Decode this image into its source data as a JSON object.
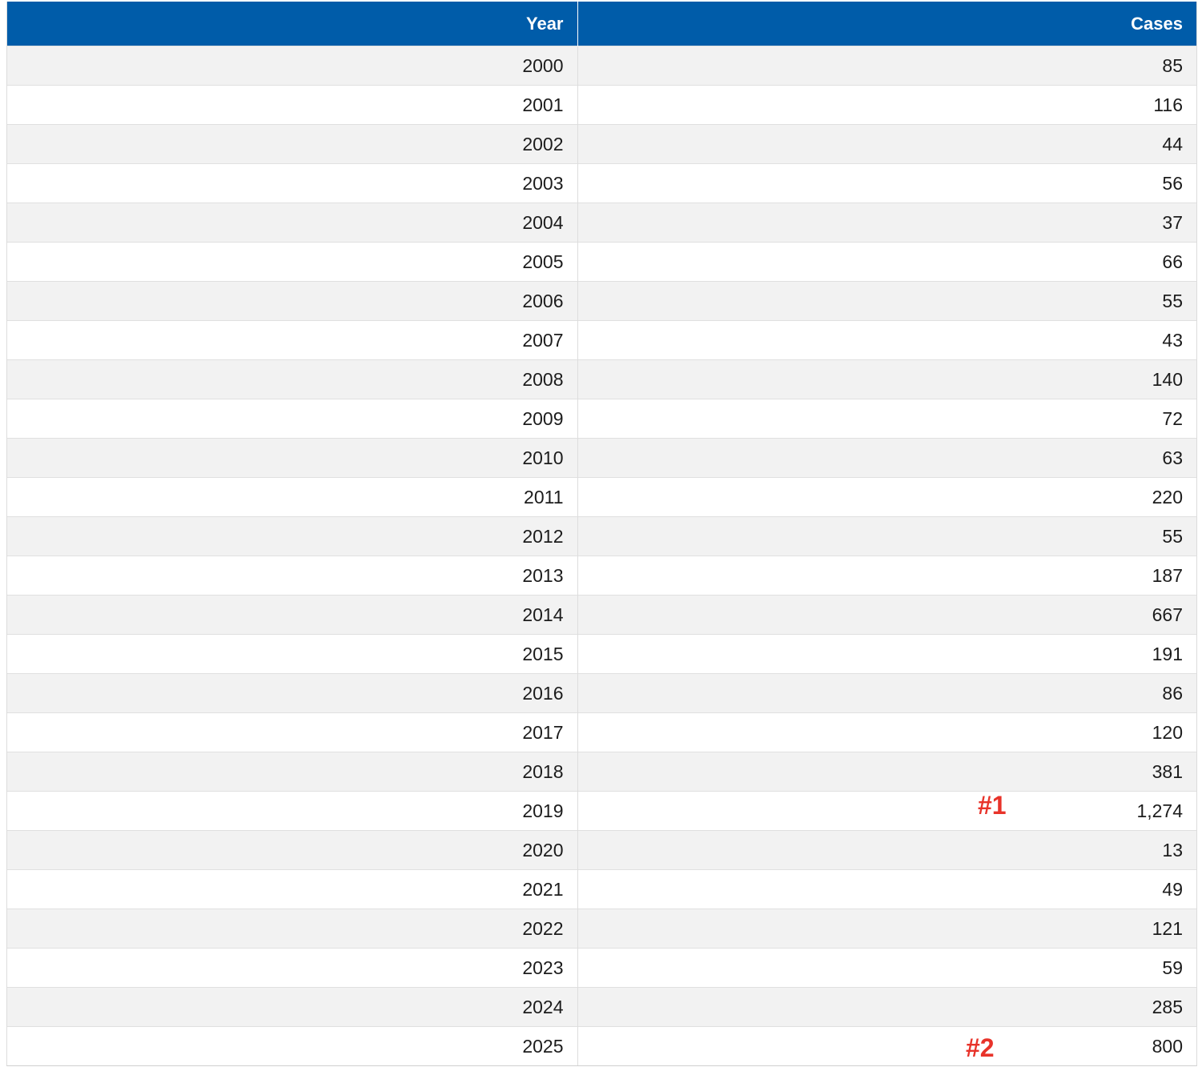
{
  "table": {
    "columns": [
      "Year",
      "Cases"
    ],
    "rows": [
      {
        "year": "2000",
        "cases": "85"
      },
      {
        "year": "2001",
        "cases": "116"
      },
      {
        "year": "2002",
        "cases": "44"
      },
      {
        "year": "2003",
        "cases": "56"
      },
      {
        "year": "2004",
        "cases": "37"
      },
      {
        "year": "2005",
        "cases": "66"
      },
      {
        "year": "2006",
        "cases": "55"
      },
      {
        "year": "2007",
        "cases": "43"
      },
      {
        "year": "2008",
        "cases": "140"
      },
      {
        "year": "2009",
        "cases": "72"
      },
      {
        "year": "2010",
        "cases": "63"
      },
      {
        "year": "2011",
        "cases": "220"
      },
      {
        "year": "2012",
        "cases": "55"
      },
      {
        "year": "2013",
        "cases": "187"
      },
      {
        "year": "2014",
        "cases": "667"
      },
      {
        "year": "2015",
        "cases": "191"
      },
      {
        "year": "2016",
        "cases": "86"
      },
      {
        "year": "2017",
        "cases": "120"
      },
      {
        "year": "2018",
        "cases": "381"
      },
      {
        "year": "2019",
        "cases": "1,274"
      },
      {
        "year": "2020",
        "cases": "13"
      },
      {
        "year": "2021",
        "cases": "49"
      },
      {
        "year": "2022",
        "cases": "121"
      },
      {
        "year": "2023",
        "cases": "59"
      },
      {
        "year": "2024",
        "cases": "285"
      },
      {
        "year": "2025",
        "cases": "800"
      }
    ]
  },
  "annotations": {
    "first": "#1",
    "second": "#2"
  },
  "colors": {
    "header_background": "#005ca9",
    "header_text": "#ffffff",
    "stripe": "#f2f2f2",
    "annotation": "#e8332a"
  }
}
